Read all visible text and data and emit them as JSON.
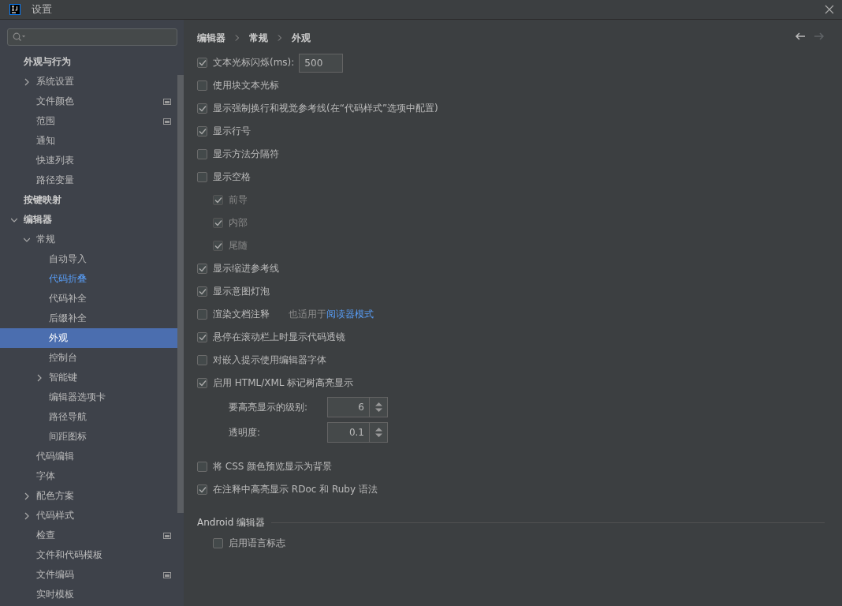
{
  "window": {
    "title": "设置"
  },
  "sidebar": {
    "header": "外观与行为",
    "items": [
      {
        "label": "系统设置",
        "expanded": false,
        "selected": false
      },
      {
        "label": "文件颜色",
        "badge": true,
        "selected": false
      },
      {
        "label": "范围",
        "badge": true,
        "selected": false
      },
      {
        "label": "通知",
        "selected": false
      },
      {
        "label": "快速列表",
        "selected": false
      },
      {
        "label": "路径变量",
        "selected": false
      },
      {
        "label": "按键映射",
        "kind": "group",
        "selected": false
      },
      {
        "label": "编辑器",
        "kind": "group",
        "expanded": true,
        "selected": false,
        "children": [
          {
            "label": "常规",
            "expanded": true,
            "selected": false,
            "children": [
              {
                "label": "自动导入",
                "selected": false
              },
              {
                "label": "代码折叠",
                "modified": true,
                "selected": false
              },
              {
                "label": "代码补全",
                "selected": false
              },
              {
                "label": "后缀补全",
                "selected": false
              },
              {
                "label": "外观",
                "selected": true
              },
              {
                "label": "控制台",
                "selected": false
              },
              {
                "label": "智能键",
                "expanded": false,
                "selected": false
              },
              {
                "label": "编辑器选项卡",
                "selected": false
              },
              {
                "label": "路径导航",
                "selected": false
              },
              {
                "label": "间距图标",
                "selected": false
              }
            ]
          },
          {
            "label": "代码编辑",
            "selected": false
          },
          {
            "label": "字体",
            "selected": false
          },
          {
            "label": "配色方案",
            "expanded": false,
            "selected": false
          },
          {
            "label": "代码样式",
            "expanded": false,
            "selected": false
          },
          {
            "label": "检查",
            "badge": true,
            "selected": false
          },
          {
            "label": "文件和代码模板",
            "selected": false
          },
          {
            "label": "文件编码",
            "badge": true,
            "selected": false
          },
          {
            "label": "实时模板",
            "selected": false
          }
        ]
      }
    ]
  },
  "breadcrumb": [
    "编辑器",
    "常规",
    "外观"
  ],
  "rows": [
    {
      "kind": "checkbox",
      "label": "文本光标闪烁(ms):",
      "checked": true,
      "value": "500"
    },
    {
      "kind": "checkbox",
      "label": "使用块文本光标",
      "checked": false
    },
    {
      "kind": "checkbox",
      "label": "显示强制换行和视觉参考线(在“代码样式”选项中配置)",
      "checked": true
    },
    {
      "kind": "checkbox",
      "label": "显示行号",
      "checked": true
    },
    {
      "kind": "checkbox",
      "label": "显示方法分隔符",
      "checked": false
    },
    {
      "kind": "checkbox",
      "label": "显示空格",
      "checked": false,
      "children": [
        {
          "kind": "checkbox",
          "label": "前导",
          "checked": true,
          "disabled": true
        },
        {
          "kind": "checkbox",
          "label": "内部",
          "checked": true,
          "disabled": true
        },
        {
          "kind": "checkbox",
          "label": "尾随",
          "checked": true,
          "disabled": true
        }
      ]
    },
    {
      "kind": "checkbox",
      "label": "显示缩进参考线",
      "checked": true
    },
    {
      "kind": "checkbox",
      "label": "显示意图灯泡",
      "checked": true
    },
    {
      "kind": "checkbox",
      "label": "渲染文档注释",
      "checked": false,
      "note": "也适用于",
      "link": "阅读器模式"
    },
    {
      "kind": "checkbox",
      "label": "悬停在滚动栏上时显示代码透镜",
      "checked": true
    },
    {
      "kind": "checkbox",
      "label": "对嵌入提示使用编辑器字体",
      "checked": false
    },
    {
      "kind": "checkbox",
      "label": "启用 HTML/XML 标记树高亮显示",
      "checked": true,
      "children": [
        {
          "kind": "spinner",
          "label": "要高亮显示的级别:",
          "value": "6"
        },
        {
          "kind": "spinner",
          "label": "透明度:",
          "value": "0.1"
        }
      ]
    },
    {
      "kind": "checkbox",
      "label": "将 CSS 颜色预览显示为背景",
      "checked": false
    },
    {
      "kind": "checkbox",
      "label": "在注释中高亮显示 RDoc 和 Ruby 语法",
      "checked": true
    }
  ],
  "sections": [
    {
      "title": "Android 编辑器",
      "rows": [
        {
          "kind": "checkbox",
          "label": "启用语言标志",
          "checked": false
        }
      ]
    }
  ]
}
